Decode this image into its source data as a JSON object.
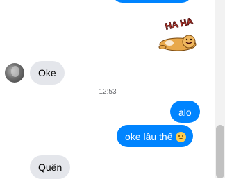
{
  "messages": {
    "sticker_text": "HA HA",
    "oke_in": "Oke",
    "timestamp": "12:53",
    "alo_out": "alo",
    "lau_out": "oke lâu thế",
    "quen_in": "Quên"
  },
  "icons": {
    "avatar": "user-avatar",
    "sad_emoji": "frowning-face-emoji",
    "sticker": "dog-laughing-sticker"
  },
  "colors": {
    "outgoing": "#0084ff",
    "incoming": "#e4e6eb"
  }
}
